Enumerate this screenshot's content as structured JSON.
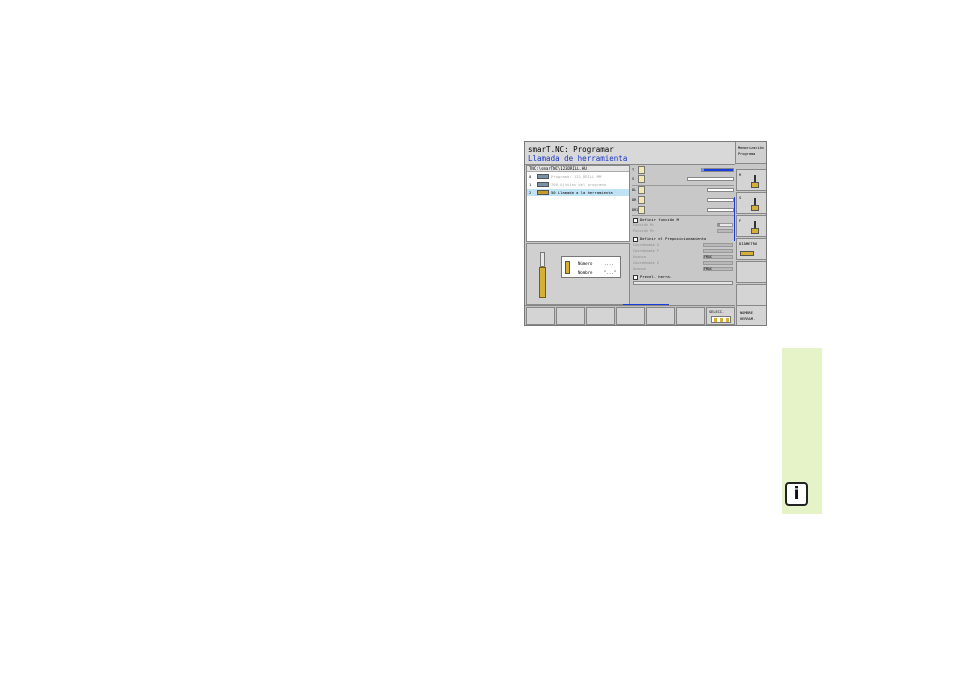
{
  "header": {
    "title": "smarT.NC: Programar",
    "subtitle": "Llamada de herramienta",
    "mode_line1": "Memorización",
    "mode_line2": "Programa"
  },
  "tree": {
    "path": "TNC:\\smarTNC\\123DRILL.HU",
    "rows": [
      {
        "num": "0",
        "text": "Programa: 123_DRILL MM"
      },
      {
        "num": "1",
        "text": "700 Ajustes del programa"
      },
      {
        "num": "2",
        "text": "50 Llamada a la herramienta"
      }
    ]
  },
  "help": {
    "label_number": "Número",
    "value_number": "....",
    "label_name": "Nombre",
    "value_name": "\"...\""
  },
  "form": {
    "t_label": "T",
    "t_value": "0",
    "s_label": "S",
    "dl_label": "DL",
    "dr_label": "DR",
    "dr2_label": "DR2",
    "m_section": "Definir función M",
    "m_field1": "Función M:",
    "m_field1_value": "0",
    "m_field2": "Función M:",
    "prepos_section": "Definir el Prеposicionamiento",
    "prepos_fields": [
      {
        "label": "Coordenada X",
        "value": ""
      },
      {
        "label": "Coordenada Y",
        "value": ""
      },
      {
        "label": "Avance",
        "value": "FMAX"
      },
      {
        "label": "Coordenada Z",
        "value": ""
      },
      {
        "label": "Avance",
        "value": "FMAX"
      }
    ],
    "preselect_section": "Preсel. herra."
  },
  "right_softkeys": [
    {
      "label": "R"
    },
    {
      "label": "S"
    },
    {
      "label": "F"
    },
    {
      "label": "DIÁMETRO"
    }
  ],
  "bottom_softkeys": {
    "select_label": "SELECC.",
    "extra_label_1": "NOMBRE",
    "extra_label_2": "HERRAM."
  },
  "info_icon_glyph": "i"
}
